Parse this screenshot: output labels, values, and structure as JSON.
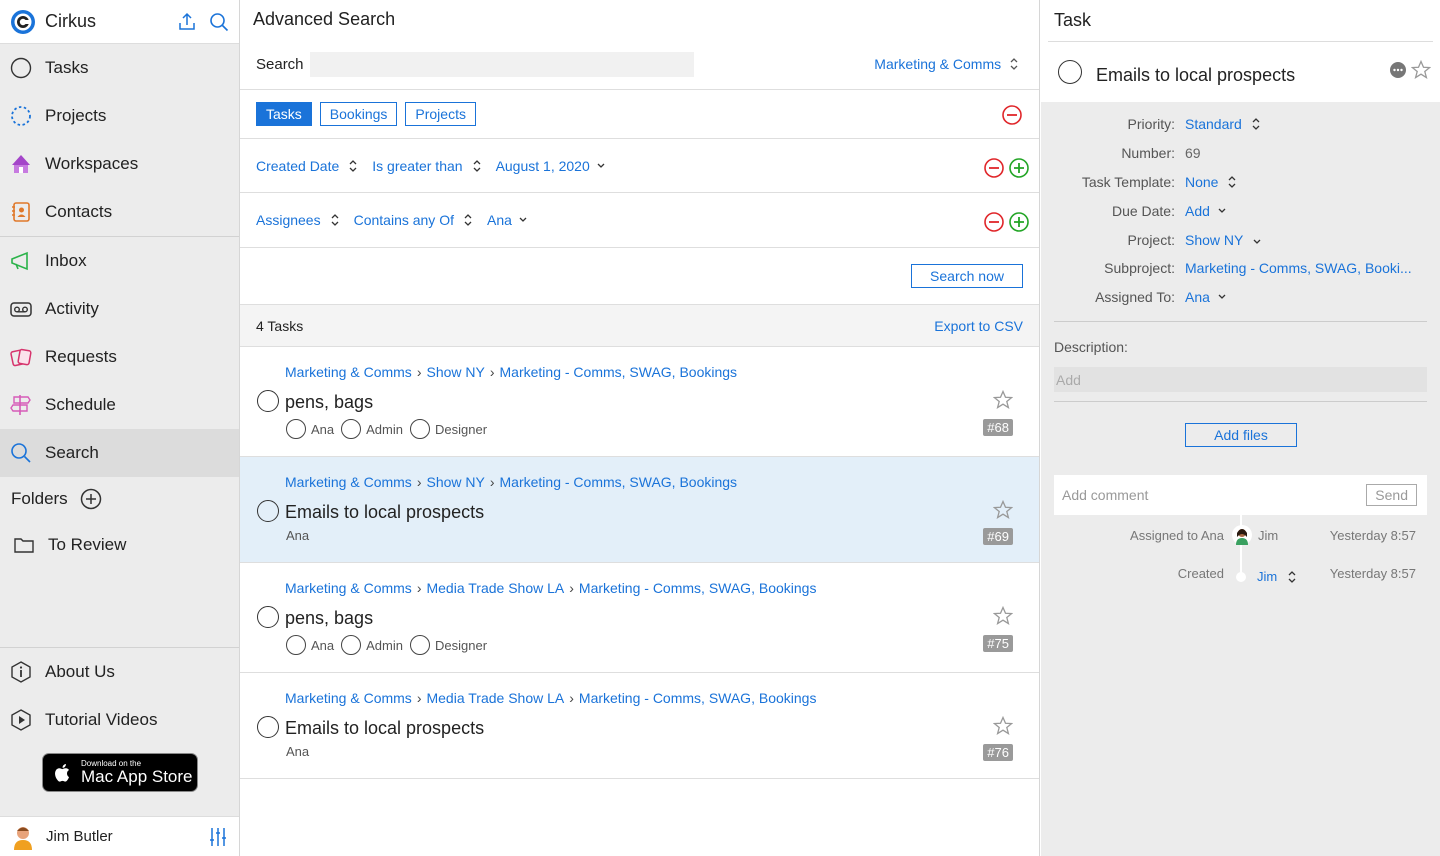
{
  "colors": {
    "accent": "#1a73d9",
    "remove": "#e0262a",
    "add": "#23a526"
  },
  "app": {
    "name": "Cirkus"
  },
  "sidebar": {
    "items": [
      {
        "label": "Tasks",
        "icon": "circle-icon"
      },
      {
        "label": "Projects",
        "icon": "dotted-circle-icon"
      },
      {
        "label": "Workspaces",
        "icon": "tent-icon"
      },
      {
        "label": "Contacts",
        "icon": "contact-book-icon"
      },
      {
        "label": "Inbox",
        "icon": "megaphone-icon"
      },
      {
        "label": "Activity",
        "icon": "voicemail-icon"
      },
      {
        "label": "Requests",
        "icon": "cards-icon"
      },
      {
        "label": "Schedule",
        "icon": "signpost-icon"
      },
      {
        "label": "Search",
        "icon": "search-icon"
      }
    ],
    "folders_label": "Folders",
    "folder_items": [
      {
        "label": "To Review"
      }
    ],
    "footer_items": [
      {
        "label": "About Us"
      },
      {
        "label": "Tutorial Videos"
      }
    ],
    "app_store": {
      "line1": "Download on the",
      "line2": "Mac App Store"
    },
    "user": {
      "name": "Jim Butler"
    }
  },
  "search": {
    "title": "Advanced Search",
    "search_label": "Search",
    "search_value": "",
    "workspace": "Marketing & Comms",
    "tabs": [
      "Tasks",
      "Bookings",
      "Projects"
    ],
    "criteria": [
      {
        "field": "Created Date",
        "operator": "Is greater than",
        "value": "August 1, 2020"
      },
      {
        "field": "Assignees",
        "operator": "Contains any Of",
        "value": "Ana"
      }
    ],
    "search_button": "Search now",
    "result_count": "4 Tasks",
    "export": "Export to CSV"
  },
  "results": [
    {
      "crumbs": [
        "Marketing & Comms",
        "Show NY",
        "Marketing - Comms, SWAG, Bookings"
      ],
      "title": "pens, bags",
      "people": [
        "Ana",
        "Admin",
        "Designer"
      ],
      "number": "#68",
      "selected": false
    },
    {
      "crumbs": [
        "Marketing & Comms",
        "Show NY",
        "Marketing - Comms, SWAG, Bookings"
      ],
      "title": "Emails to local prospects",
      "assignee": "Ana",
      "number": "#69",
      "selected": true
    },
    {
      "crumbs": [
        "Marketing & Comms",
        "Media Trade Show LA",
        "Marketing - Comms, SWAG, Bookings"
      ],
      "title": "pens, bags",
      "people": [
        "Ana",
        "Admin",
        "Designer"
      ],
      "number": "#75",
      "selected": false
    },
    {
      "crumbs": [
        "Marketing & Comms",
        "Media Trade Show LA",
        "Marketing - Comms, SWAG, Bookings"
      ],
      "title": "Emails to local prospects",
      "assignee": "Ana",
      "number": "#76",
      "selected": false
    }
  ],
  "task": {
    "header": "Task",
    "name": "Emails to local prospects",
    "fields": [
      {
        "label": "Priority:",
        "value": "Standard"
      },
      {
        "label": "Number:",
        "value": "69"
      },
      {
        "label": "Task Template:",
        "value": "None"
      },
      {
        "label": "Due Date:",
        "value": "Add"
      },
      {
        "label": "Project:",
        "value": "Show NY"
      },
      {
        "label": "Subproject:",
        "value": "Marketing - Comms, SWAG, Booki..."
      },
      {
        "label": "Assigned To:",
        "value": "Ana"
      }
    ],
    "description_label": "Description:",
    "description_placeholder": "Add",
    "add_files": "Add files",
    "comment_placeholder": "Add comment",
    "send": "Send",
    "activity": [
      {
        "label": "Assigned to Ana",
        "name": "Jim",
        "time": "Yesterday 8:57"
      },
      {
        "label": "Created",
        "name": "Jim",
        "time": "Yesterday 8:57"
      }
    ]
  }
}
